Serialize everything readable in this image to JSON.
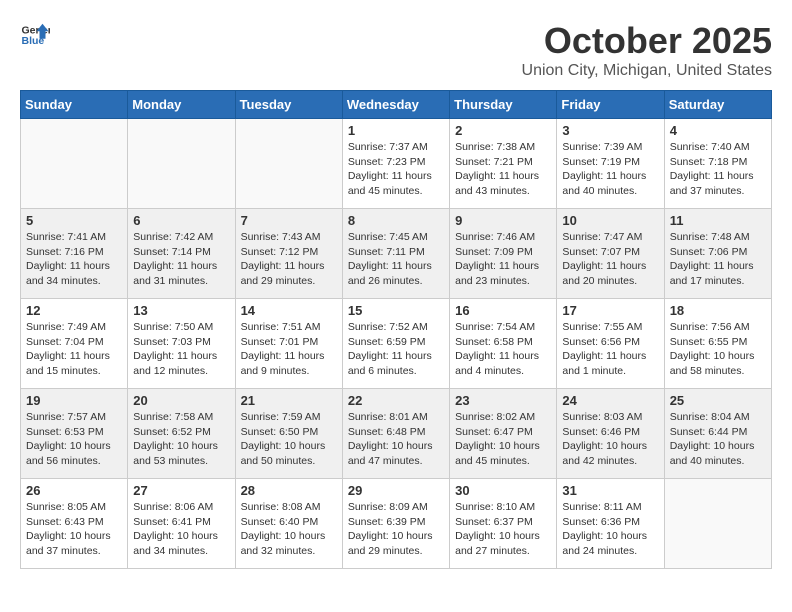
{
  "header": {
    "logo_general": "General",
    "logo_blue": "Blue",
    "month": "October 2025",
    "location": "Union City, Michigan, United States"
  },
  "weekdays": [
    "Sunday",
    "Monday",
    "Tuesday",
    "Wednesday",
    "Thursday",
    "Friday",
    "Saturday"
  ],
  "weeks": [
    [
      null,
      null,
      null,
      {
        "day": "1",
        "sunrise": "7:37 AM",
        "sunset": "7:23 PM",
        "daylight": "11 hours and 45 minutes."
      },
      {
        "day": "2",
        "sunrise": "7:38 AM",
        "sunset": "7:21 PM",
        "daylight": "11 hours and 43 minutes."
      },
      {
        "day": "3",
        "sunrise": "7:39 AM",
        "sunset": "7:19 PM",
        "daylight": "11 hours and 40 minutes."
      },
      {
        "day": "4",
        "sunrise": "7:40 AM",
        "sunset": "7:18 PM",
        "daylight": "11 hours and 37 minutes."
      }
    ],
    [
      {
        "day": "5",
        "sunrise": "7:41 AM",
        "sunset": "7:16 PM",
        "daylight": "11 hours and 34 minutes."
      },
      {
        "day": "6",
        "sunrise": "7:42 AM",
        "sunset": "7:14 PM",
        "daylight": "11 hours and 31 minutes."
      },
      {
        "day": "7",
        "sunrise": "7:43 AM",
        "sunset": "7:12 PM",
        "daylight": "11 hours and 29 minutes."
      },
      {
        "day": "8",
        "sunrise": "7:45 AM",
        "sunset": "7:11 PM",
        "daylight": "11 hours and 26 minutes."
      },
      {
        "day": "9",
        "sunrise": "7:46 AM",
        "sunset": "7:09 PM",
        "daylight": "11 hours and 23 minutes."
      },
      {
        "day": "10",
        "sunrise": "7:47 AM",
        "sunset": "7:07 PM",
        "daylight": "11 hours and 20 minutes."
      },
      {
        "day": "11",
        "sunrise": "7:48 AM",
        "sunset": "7:06 PM",
        "daylight": "11 hours and 17 minutes."
      }
    ],
    [
      {
        "day": "12",
        "sunrise": "7:49 AM",
        "sunset": "7:04 PM",
        "daylight": "11 hours and 15 minutes."
      },
      {
        "day": "13",
        "sunrise": "7:50 AM",
        "sunset": "7:03 PM",
        "daylight": "11 hours and 12 minutes."
      },
      {
        "day": "14",
        "sunrise": "7:51 AM",
        "sunset": "7:01 PM",
        "daylight": "11 hours and 9 minutes."
      },
      {
        "day": "15",
        "sunrise": "7:52 AM",
        "sunset": "6:59 PM",
        "daylight": "11 hours and 6 minutes."
      },
      {
        "day": "16",
        "sunrise": "7:54 AM",
        "sunset": "6:58 PM",
        "daylight": "11 hours and 4 minutes."
      },
      {
        "day": "17",
        "sunrise": "7:55 AM",
        "sunset": "6:56 PM",
        "daylight": "11 hours and 1 minute."
      },
      {
        "day": "18",
        "sunrise": "7:56 AM",
        "sunset": "6:55 PM",
        "daylight": "10 hours and 58 minutes."
      }
    ],
    [
      {
        "day": "19",
        "sunrise": "7:57 AM",
        "sunset": "6:53 PM",
        "daylight": "10 hours and 56 minutes."
      },
      {
        "day": "20",
        "sunrise": "7:58 AM",
        "sunset": "6:52 PM",
        "daylight": "10 hours and 53 minutes."
      },
      {
        "day": "21",
        "sunrise": "7:59 AM",
        "sunset": "6:50 PM",
        "daylight": "10 hours and 50 minutes."
      },
      {
        "day": "22",
        "sunrise": "8:01 AM",
        "sunset": "6:48 PM",
        "daylight": "10 hours and 47 minutes."
      },
      {
        "day": "23",
        "sunrise": "8:02 AM",
        "sunset": "6:47 PM",
        "daylight": "10 hours and 45 minutes."
      },
      {
        "day": "24",
        "sunrise": "8:03 AM",
        "sunset": "6:46 PM",
        "daylight": "10 hours and 42 minutes."
      },
      {
        "day": "25",
        "sunrise": "8:04 AM",
        "sunset": "6:44 PM",
        "daylight": "10 hours and 40 minutes."
      }
    ],
    [
      {
        "day": "26",
        "sunrise": "8:05 AM",
        "sunset": "6:43 PM",
        "daylight": "10 hours and 37 minutes."
      },
      {
        "day": "27",
        "sunrise": "8:06 AM",
        "sunset": "6:41 PM",
        "daylight": "10 hours and 34 minutes."
      },
      {
        "day": "28",
        "sunrise": "8:08 AM",
        "sunset": "6:40 PM",
        "daylight": "10 hours and 32 minutes."
      },
      {
        "day": "29",
        "sunrise": "8:09 AM",
        "sunset": "6:39 PM",
        "daylight": "10 hours and 29 minutes."
      },
      {
        "day": "30",
        "sunrise": "8:10 AM",
        "sunset": "6:37 PM",
        "daylight": "10 hours and 27 minutes."
      },
      {
        "day": "31",
        "sunrise": "8:11 AM",
        "sunset": "6:36 PM",
        "daylight": "10 hours and 24 minutes."
      },
      null
    ]
  ],
  "labels": {
    "sunrise": "Sunrise:",
    "sunset": "Sunset:",
    "daylight": "Daylight:"
  }
}
